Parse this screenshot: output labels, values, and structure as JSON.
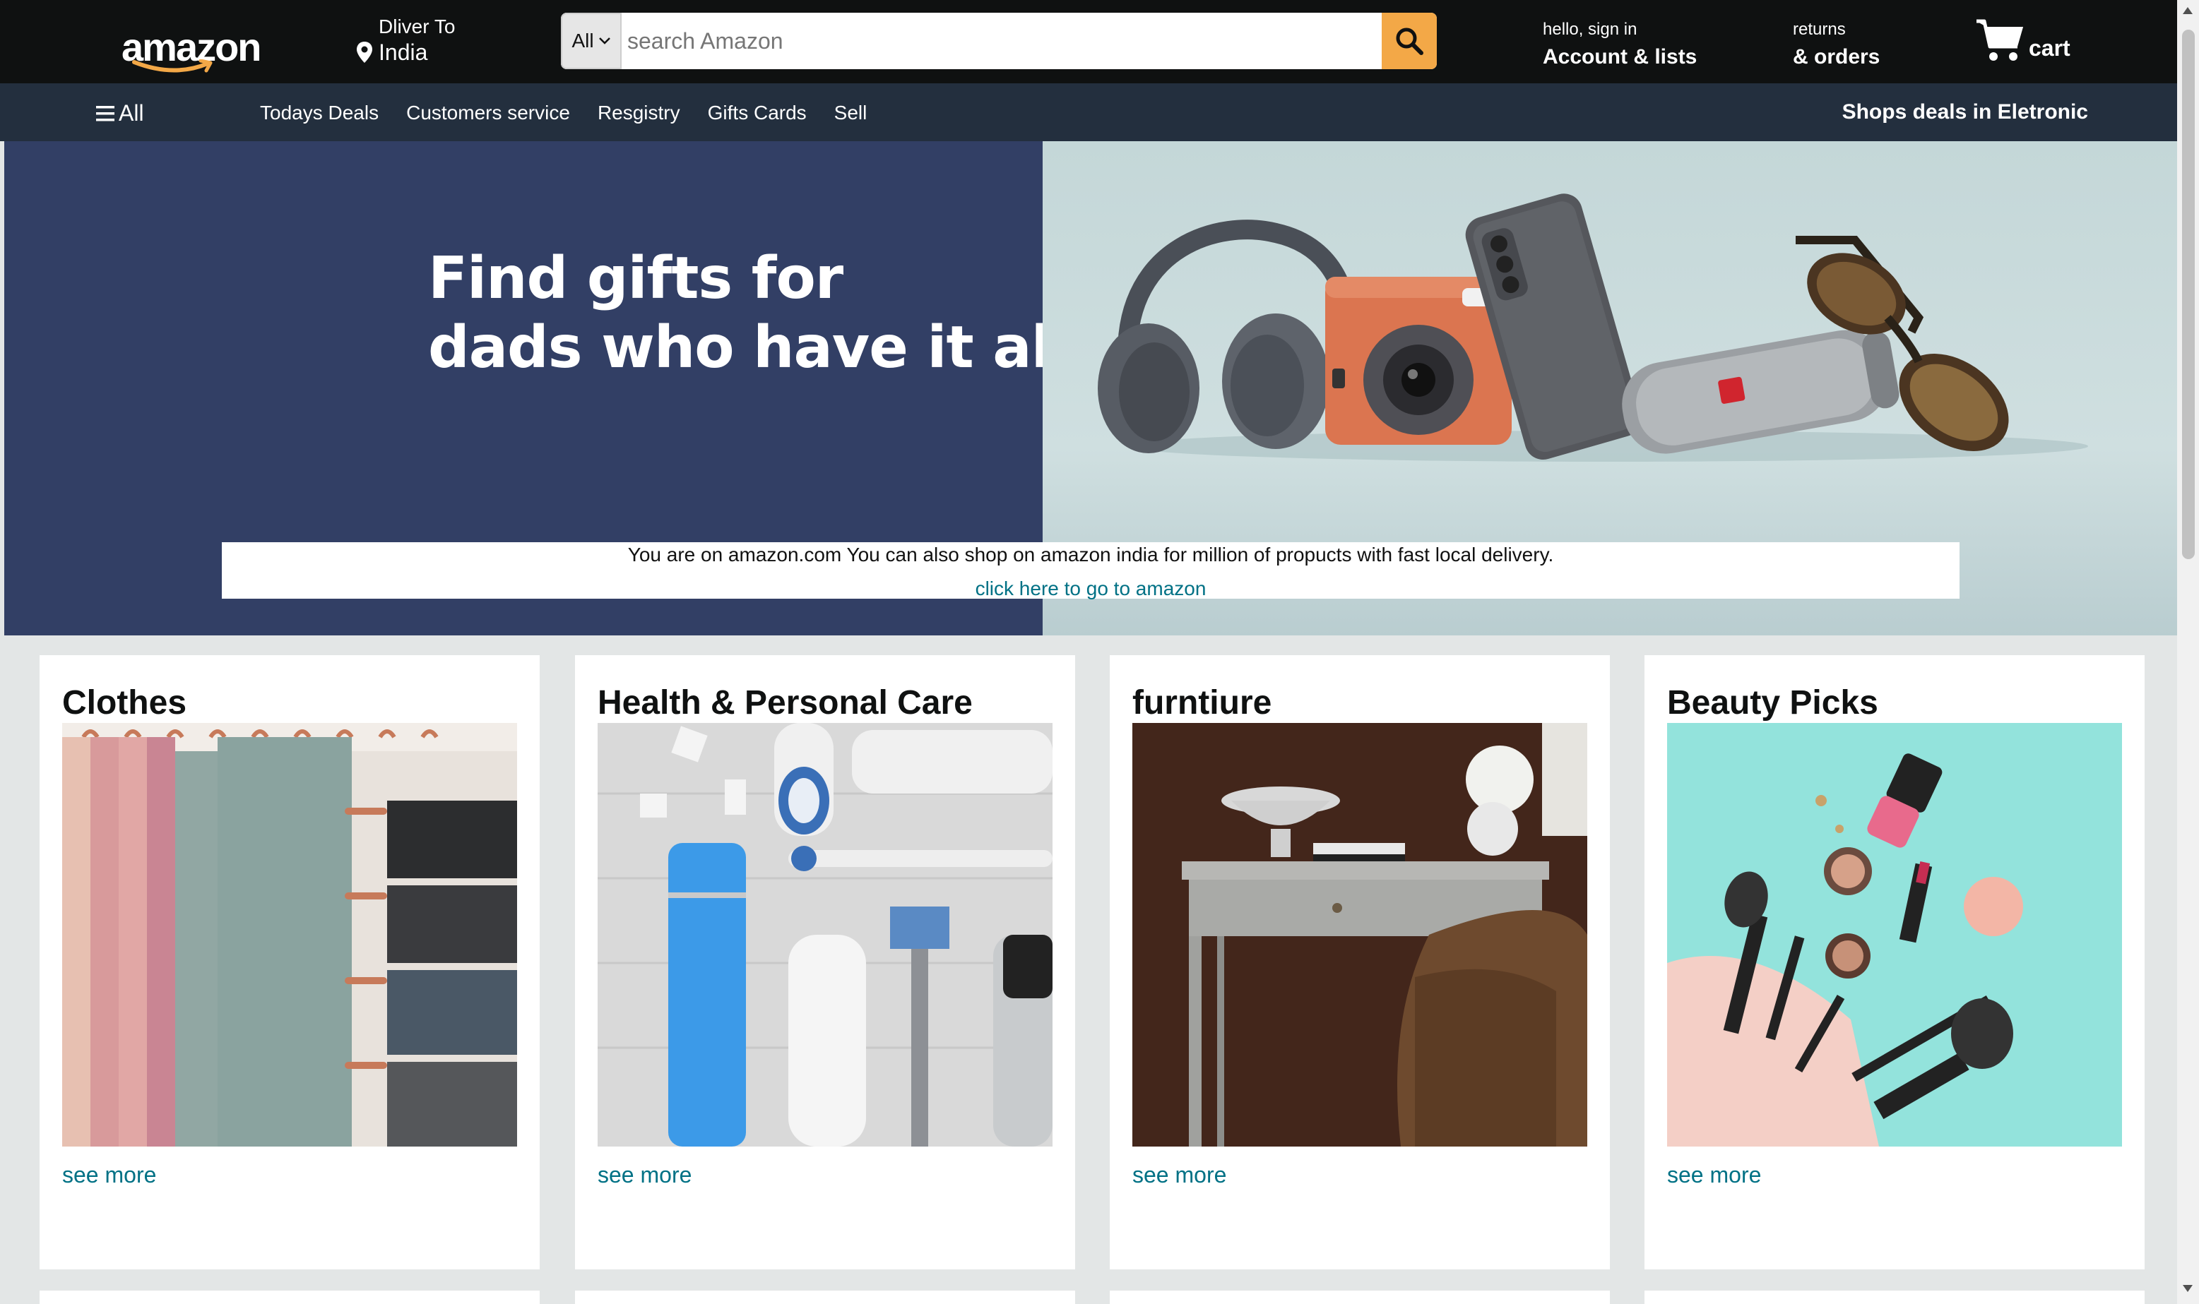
{
  "header": {
    "logo_text": "amazon",
    "deliver_label": "Dliver To",
    "deliver_country": "India",
    "search": {
      "category": "All",
      "placeholder": "search Amazon"
    },
    "account": {
      "greeting": "hello, sign in",
      "label": "Account & lists"
    },
    "returns": {
      "small": "returns",
      "big": "& orders"
    },
    "cart_label": "cart"
  },
  "subnav": {
    "all_label": "All",
    "links": [
      "Todays Deals",
      "Customers service",
      "Resgistry",
      "Gifts Cards",
      "Sell"
    ],
    "promo": "Shops deals in Eletronic"
  },
  "hero": {
    "title_line1": "Find gifts for",
    "title_line2": "dads who have it all",
    "notice_text": "You are on amazon.com You can also shop on amazon india for million of propucts with fast local delivery.",
    "notice_link": "click here to go to amazon"
  },
  "cards": [
    {
      "title": "Clothes",
      "link": "see more"
    },
    {
      "title": "Health & Personal Care",
      "link": "see more"
    },
    {
      "title": "furntiure",
      "link": "see more"
    },
    {
      "title": "Beauty Picks",
      "link": "see more"
    }
  ],
  "colors": {
    "nav_bg": "#0f1111",
    "subnav_bg": "#232f3e",
    "hero_left": "#323f65",
    "search_button": "#f3a847",
    "link": "#007185",
    "page_bg": "#e3e6e6"
  },
  "icons": [
    "location-pin-icon",
    "chevron-down-icon",
    "search-icon",
    "cart-icon",
    "hamburger-icon",
    "scroll-up-arrow-icon",
    "scroll-down-arrow-icon"
  ]
}
